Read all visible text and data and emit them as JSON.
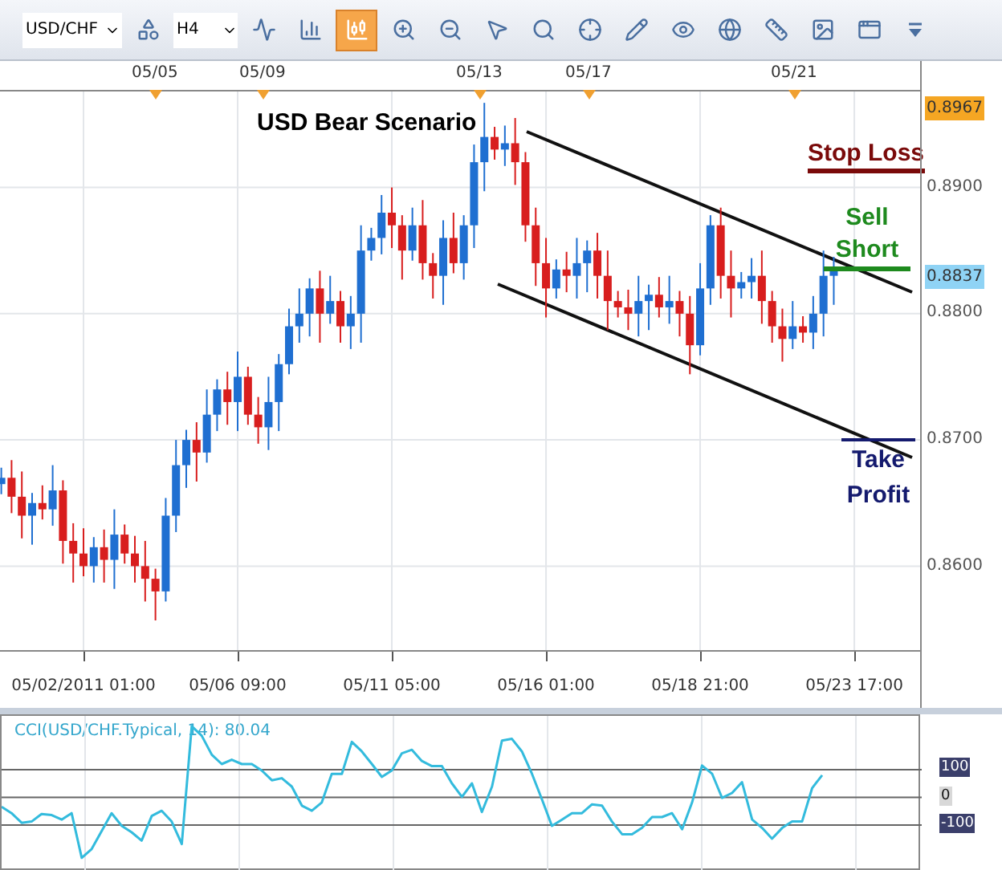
{
  "toolbar": {
    "symbol": "USD/CHF",
    "timeframe": "H4",
    "tools": [
      {
        "kind": "objects",
        "selected": false
      },
      {
        "kind": "indicator",
        "selected": false
      },
      {
        "kind": "bar-type",
        "selected": false
      },
      {
        "kind": "candle-type",
        "selected": true
      },
      {
        "kind": "zoom-in",
        "selected": false
      },
      {
        "kind": "zoom-out",
        "selected": false
      },
      {
        "kind": "cursor",
        "selected": false
      },
      {
        "kind": "zoom-range",
        "selected": false
      },
      {
        "kind": "crosshair",
        "selected": false
      },
      {
        "kind": "edit",
        "selected": false
      },
      {
        "kind": "eye",
        "selected": false
      },
      {
        "kind": "globe",
        "selected": false
      },
      {
        "kind": "ruler",
        "selected": false
      },
      {
        "kind": "image",
        "selected": false
      },
      {
        "kind": "window",
        "selected": false
      },
      {
        "kind": "more",
        "selected": false
      }
    ]
  },
  "top_axis": [
    "05/05",
    "05/09",
    "05/13",
    "05/17",
    "05/21"
  ],
  "annotations": [
    {
      "kind": "title",
      "text": "USD Bear Scenario",
      "color": "#000000"
    },
    {
      "kind": "stop-loss",
      "text": "Stop Loss",
      "color": "#7a0a0a"
    },
    {
      "kind": "sell",
      "text": "Sell Short",
      "color": "#1e8a1e"
    },
    {
      "kind": "take-profit",
      "text": "Take Profit",
      "color": "#141a6e"
    }
  ],
  "price_chart": {
    "chart_data": {
      "type": "candlestick",
      "grid": true,
      "ylim": [
        0.8489,
        0.8976
      ],
      "categories": [
        null,
        null,
        null,
        null,
        null,
        null,
        null,
        null,
        "05/02/2011 01:00",
        null,
        null,
        null,
        null,
        null,
        null,
        null,
        null,
        null,
        null,
        null,
        null,
        null,
        null,
        "05/06 09:00",
        null,
        null,
        null,
        null,
        null,
        null,
        null,
        null,
        null,
        null,
        null,
        null,
        null,
        null,
        "05/11 05:00",
        null,
        null,
        null,
        null,
        null,
        null,
        null,
        null,
        null,
        null,
        null,
        null,
        null,
        null,
        "05/16 01:00",
        null,
        null,
        null,
        null,
        null,
        null,
        null,
        null,
        null,
        null,
        null,
        null,
        null,
        null,
        "05/18 21:00",
        null,
        null,
        null,
        null,
        null,
        null,
        null,
        null,
        null,
        null,
        null,
        null,
        null,
        null,
        "05/23 17:00"
      ],
      "yticks": [
        {
          "value": 0.89,
          "label": "0.8900"
        },
        {
          "value": 0.88,
          "label": "0.8800"
        },
        {
          "value": 0.87,
          "label": "0.8700"
        },
        {
          "value": 0.86,
          "label": "0.8600"
        }
      ],
      "ohlc": [
        [
          0.8665,
          0.8678,
          0.8657,
          0.867
        ],
        [
          0.867,
          0.8684,
          0.8642,
          0.8655
        ],
        [
          0.8655,
          0.8675,
          0.8622,
          0.864
        ],
        [
          0.864,
          0.8658,
          0.8617,
          0.865
        ],
        [
          0.865,
          0.8664,
          0.8637,
          0.8645
        ],
        [
          0.8645,
          0.868,
          0.8632,
          0.866
        ],
        [
          0.866,
          0.8668,
          0.8602,
          0.862
        ],
        [
          0.862,
          0.8634,
          0.8587,
          0.861
        ],
        [
          0.861,
          0.863,
          0.8592,
          0.86
        ],
        [
          0.86,
          0.8623,
          0.8587,
          0.8615
        ],
        [
          0.8615,
          0.8629,
          0.8587,
          0.8605
        ],
        [
          0.8605,
          0.8645,
          0.8582,
          0.8625
        ],
        [
          0.8625,
          0.8633,
          0.8602,
          0.861
        ],
        [
          0.861,
          0.8624,
          0.8587,
          0.86
        ],
        [
          0.86,
          0.862,
          0.8572,
          0.859
        ],
        [
          0.859,
          0.8598,
          0.8557,
          0.858
        ],
        [
          0.858,
          0.8654,
          0.8572,
          0.864
        ],
        [
          0.864,
          0.87,
          0.8627,
          0.868
        ],
        [
          0.868,
          0.8708,
          0.8662,
          0.87
        ],
        [
          0.87,
          0.8714,
          0.8667,
          0.869
        ],
        [
          0.869,
          0.874,
          0.8682,
          0.872
        ],
        [
          0.872,
          0.8748,
          0.8707,
          0.874
        ],
        [
          0.874,
          0.8754,
          0.8712,
          0.873
        ],
        [
          0.873,
          0.877,
          0.8707,
          0.875
        ],
        [
          0.875,
          0.8758,
          0.8712,
          0.872
        ],
        [
          0.872,
          0.8734,
          0.8697,
          0.871
        ],
        [
          0.871,
          0.875,
          0.8692,
          0.873
        ],
        [
          0.873,
          0.8768,
          0.8707,
          0.876
        ],
        [
          0.876,
          0.8804,
          0.8752,
          0.879
        ],
        [
          0.879,
          0.882,
          0.8777,
          0.88
        ],
        [
          0.88,
          0.8828,
          0.8782,
          0.882
        ],
        [
          0.882,
          0.8834,
          0.8777,
          0.88
        ],
        [
          0.88,
          0.883,
          0.8792,
          0.881
        ],
        [
          0.881,
          0.8818,
          0.8777,
          0.879
        ],
        [
          0.879,
          0.8814,
          0.8772,
          0.88
        ],
        [
          0.88,
          0.887,
          0.8777,
          0.885
        ],
        [
          0.885,
          0.8868,
          0.8842,
          0.886
        ],
        [
          0.886,
          0.8894,
          0.8847,
          0.888
        ],
        [
          0.888,
          0.89,
          0.8852,
          0.887
        ],
        [
          0.887,
          0.8878,
          0.8827,
          0.885
        ],
        [
          0.885,
          0.8884,
          0.8842,
          0.887
        ],
        [
          0.887,
          0.889,
          0.8827,
          0.884
        ],
        [
          0.884,
          0.8848,
          0.8812,
          0.883
        ],
        [
          0.883,
          0.8874,
          0.8807,
          0.886
        ],
        [
          0.886,
          0.888,
          0.8832,
          0.884
        ],
        [
          0.884,
          0.8878,
          0.8827,
          0.887
        ],
        [
          0.887,
          0.8934,
          0.8852,
          0.892
        ],
        [
          0.892,
          0.8967,
          0.8897,
          0.894
        ],
        [
          0.894,
          0.8948,
          0.8922,
          0.893
        ],
        [
          0.893,
          0.8949,
          0.8917,
          0.8935
        ],
        [
          0.8935,
          0.8955,
          0.8902,
          0.892
        ],
        [
          0.892,
          0.8928,
          0.8857,
          0.887
        ],
        [
          0.887,
          0.8884,
          0.8822,
          0.884
        ],
        [
          0.884,
          0.886,
          0.8797,
          0.882
        ],
        [
          0.882,
          0.8843,
          0.8812,
          0.8835
        ],
        [
          0.8835,
          0.8849,
          0.8817,
          0.883
        ],
        [
          0.883,
          0.886,
          0.8812,
          0.884
        ],
        [
          0.884,
          0.8858,
          0.8817,
          0.885
        ],
        [
          0.885,
          0.8864,
          0.8812,
          0.883
        ],
        [
          0.883,
          0.885,
          0.8787,
          0.881
        ],
        [
          0.881,
          0.8818,
          0.8797,
          0.8805
        ],
        [
          0.8805,
          0.8819,
          0.8787,
          0.88
        ],
        [
          0.88,
          0.883,
          0.8782,
          0.881
        ],
        [
          0.881,
          0.8823,
          0.8787,
          0.8815
        ],
        [
          0.8815,
          0.8829,
          0.8797,
          0.8805
        ],
        [
          0.8805,
          0.883,
          0.8792,
          0.881
        ],
        [
          0.881,
          0.8818,
          0.8782,
          0.88
        ],
        [
          0.88,
          0.8814,
          0.8752,
          0.8775
        ],
        [
          0.8775,
          0.884,
          0.8767,
          0.882
        ],
        [
          0.882,
          0.8878,
          0.8807,
          0.887
        ],
        [
          0.887,
          0.8884,
          0.8812,
          0.883
        ],
        [
          0.883,
          0.885,
          0.8797,
          0.882
        ],
        [
          0.882,
          0.8833,
          0.8812,
          0.8825
        ],
        [
          0.8825,
          0.8844,
          0.8812,
          0.883
        ],
        [
          0.883,
          0.885,
          0.8792,
          0.881
        ],
        [
          0.881,
          0.8818,
          0.8777,
          0.879
        ],
        [
          0.879,
          0.8804,
          0.8762,
          0.878
        ],
        [
          0.878,
          0.881,
          0.8772,
          0.879
        ],
        [
          0.879,
          0.8798,
          0.8777,
          0.8785
        ],
        [
          0.8785,
          0.8814,
          0.8772,
          0.88
        ],
        [
          0.88,
          0.885,
          0.8782,
          0.883
        ],
        [
          0.883,
          0.8845,
          0.8807,
          0.8837
        ],
        null,
        null
      ]
    }
  },
  "price_markers": [
    {
      "label": "0.8967",
      "kind": "high"
    },
    {
      "label": "0.8837",
      "kind": "current"
    }
  ],
  "indicator": {
    "label": "CCI(USD/CHF.Typical, 14): 80.04",
    "levels": [
      {
        "label": "100",
        "kind": "band"
      },
      {
        "label": "0",
        "kind": "zero"
      },
      {
        "label": "-100",
        "kind": "band"
      }
    ],
    "chart_data": {
      "type": "line",
      "grid": true,
      "ylim": [
        -262,
        294
      ],
      "yticks": [
        100,
        0,
        -100
      ],
      "series": [
        {
          "color": "#33bbdd",
          "values": [
            -34,
            -57,
            -92,
            -87,
            -60,
            -64,
            -80,
            -57,
            -218,
            -186,
            -122,
            -57,
            -103,
            -126,
            -156,
            -67,
            -48,
            -87,
            -168,
            257,
            223,
            154,
            120,
            136,
            120,
            120,
            97,
            62,
            69,
            39,
            -30,
            -48,
            -18,
            85,
            85,
            200,
            166,
            120,
            74,
            97,
            159,
            172,
            131,
            113,
            113,
            51,
            2,
            51,
            -53,
            39,
            205,
            211,
            166,
            85,
            -7,
            -103,
            -80,
            -57,
            -57,
            -25,
            -30,
            -87,
            -133,
            -133,
            -110,
            -71,
            -71,
            -57,
            -115,
            -18,
            115,
            85,
            -2,
            16,
            55,
            -80,
            -110,
            -149,
            -110,
            -87,
            -87,
            34,
            80
          ]
        }
      ]
    }
  }
}
